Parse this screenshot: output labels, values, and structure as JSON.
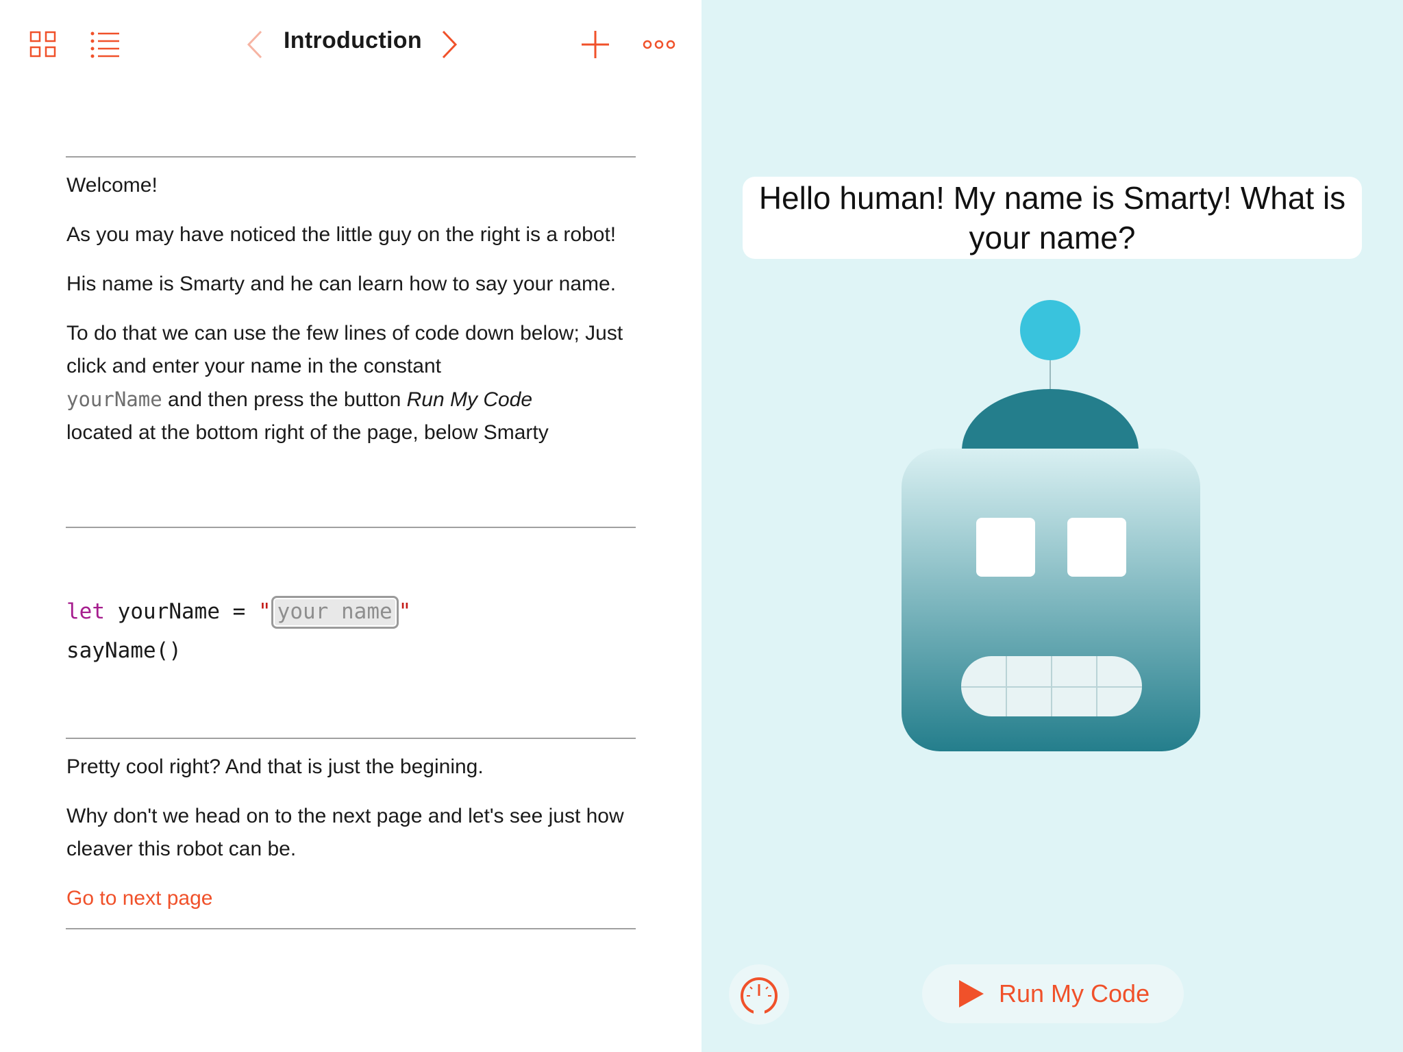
{
  "toolbar": {
    "title": "Introduction",
    "icons": [
      "grid-icon",
      "list-icon",
      "chevron-left-icon",
      "chevron-right-icon",
      "plus-icon",
      "more-icon"
    ],
    "accent_color": "#f0512a"
  },
  "intro": {
    "welcome": "Welcome!",
    "p1": "As you may have noticed the little guy on the right is a robot!",
    "p2": "His name is Smarty and he can learn how to say your name.",
    "p3_part1": "To do that we can use the few lines of code down below; Just click and enter your name in the constant",
    "p3_code": "yourName",
    "p3_part2": "and then press the button",
    "p3_italic": "Run My Code",
    "p3_part3": "located at the bottom right of the page, below Smarty"
  },
  "code": {
    "keyword": "let",
    "identifier": "yourName",
    "equals": "=",
    "quote_open": "\"",
    "placeholder": "your name",
    "quote_close": "\"",
    "call": "sayName()"
  },
  "outro": {
    "p1": "Pretty cool right? And that is just the begining.",
    "p2": "Why don't we head on to the next page and let's see just how cleaver this robot can be.",
    "link": "Go to next page"
  },
  "live_view": {
    "speech": "Hello human! My name is Smarty! What is your name?",
    "run_label": "Run My Code",
    "background_color": "#dff4f6",
    "robot_colors": {
      "antenna": "#39c3dd",
      "dome": "#247e8c",
      "head_top": "#d6eef1",
      "head_bottom": "#247e8c"
    }
  }
}
